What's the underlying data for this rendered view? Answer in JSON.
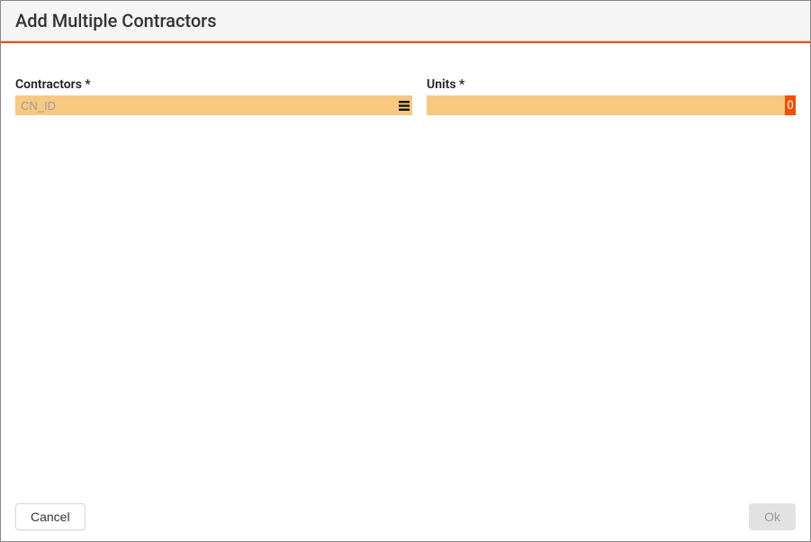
{
  "header": {
    "title": "Add Multiple Contractors"
  },
  "form": {
    "contractors": {
      "label": "Contractors *",
      "placeholder": "CN_ID",
      "value": ""
    },
    "units": {
      "label": "Units *",
      "value": "0"
    }
  },
  "footer": {
    "cancel_label": "Cancel",
    "ok_label": "Ok"
  }
}
